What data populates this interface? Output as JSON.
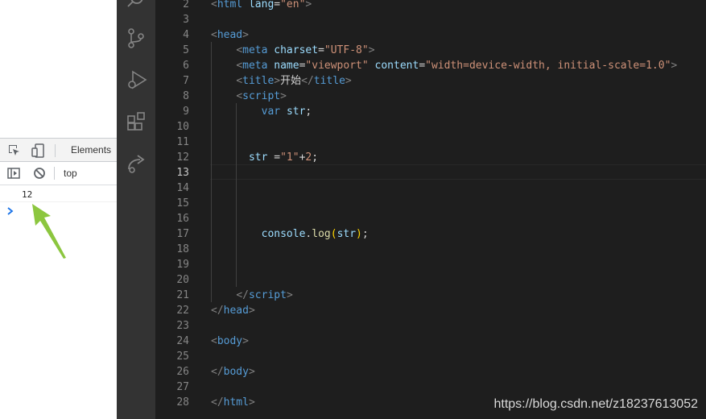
{
  "devtools": {
    "tab_label": "Elements",
    "context_label": "top",
    "console_output": "12",
    "icons": [
      "inspect-element-icon",
      "device-toggle-icon",
      "sidebar-toggle-icon",
      "clear-console-icon",
      "prompt-chevron-icon"
    ]
  },
  "activity_bar": {
    "icons": [
      "search-icon",
      "source-control-icon",
      "run-debug-icon",
      "extensions-icon",
      "remote-icon"
    ]
  },
  "editor": {
    "active_line": "13",
    "lines": [
      {
        "n": "2",
        "tokens": [
          [
            "t-punc",
            "<"
          ],
          [
            "t-tag",
            "html"
          ],
          [
            "t-txt",
            " "
          ],
          [
            "t-attr",
            "lang"
          ],
          [
            "t-txt",
            "="
          ],
          [
            "t-str",
            "\"en\""
          ],
          [
            "t-punc",
            ">"
          ]
        ]
      },
      {
        "n": "3",
        "tokens": []
      },
      {
        "n": "4",
        "tokens": [
          [
            "t-punc",
            "<"
          ],
          [
            "t-tag",
            "head"
          ],
          [
            "t-punc",
            ">"
          ]
        ]
      },
      {
        "n": "5",
        "tokens": [
          [
            "t-txt",
            "    "
          ],
          [
            "t-punc",
            "<"
          ],
          [
            "t-tag",
            "meta"
          ],
          [
            "t-txt",
            " "
          ],
          [
            "t-attr",
            "charset"
          ],
          [
            "t-txt",
            "="
          ],
          [
            "t-str",
            "\"UTF-8\""
          ],
          [
            "t-punc",
            ">"
          ]
        ]
      },
      {
        "n": "6",
        "tokens": [
          [
            "t-txt",
            "    "
          ],
          [
            "t-punc",
            "<"
          ],
          [
            "t-tag",
            "meta"
          ],
          [
            "t-txt",
            " "
          ],
          [
            "t-attr",
            "name"
          ],
          [
            "t-txt",
            "="
          ],
          [
            "t-str",
            "\"viewport\""
          ],
          [
            "t-txt",
            " "
          ],
          [
            "t-attr",
            "content"
          ],
          [
            "t-txt",
            "="
          ],
          [
            "t-str",
            "\"width=device-width, initial-scale=1.0\""
          ],
          [
            "t-punc",
            ">"
          ]
        ]
      },
      {
        "n": "7",
        "tokens": [
          [
            "t-txt",
            "    "
          ],
          [
            "t-punc",
            "<"
          ],
          [
            "t-tag",
            "title"
          ],
          [
            "t-punc",
            ">"
          ],
          [
            "t-txt",
            "开始"
          ],
          [
            "t-punc",
            "</"
          ],
          [
            "t-tag",
            "title"
          ],
          [
            "t-punc",
            ">"
          ]
        ]
      },
      {
        "n": "8",
        "tokens": [
          [
            "t-txt",
            "    "
          ],
          [
            "t-punc",
            "<"
          ],
          [
            "t-tag",
            "script"
          ],
          [
            "t-punc",
            ">"
          ]
        ]
      },
      {
        "n": "9",
        "tokens": [
          [
            "t-txt",
            "        "
          ],
          [
            "t-kw",
            "var"
          ],
          [
            "t-txt",
            " "
          ],
          [
            "t-var",
            "str"
          ],
          [
            "t-txt",
            ";"
          ]
        ]
      },
      {
        "n": "10",
        "tokens": []
      },
      {
        "n": "11",
        "tokens": []
      },
      {
        "n": "12",
        "tokens": [
          [
            "t-txt",
            "      "
          ],
          [
            "t-var",
            "str"
          ],
          [
            "t-txt",
            " ="
          ],
          [
            "t-str",
            "\"1\""
          ],
          [
            "t-txt",
            "+"
          ],
          [
            "t-str",
            "2"
          ],
          [
            "t-txt",
            ";"
          ]
        ]
      },
      {
        "n": "13",
        "tokens": []
      },
      {
        "n": "14",
        "tokens": []
      },
      {
        "n": "15",
        "tokens": []
      },
      {
        "n": "16",
        "tokens": []
      },
      {
        "n": "17",
        "tokens": [
          [
            "t-txt",
            "        "
          ],
          [
            "t-var",
            "console"
          ],
          [
            "t-txt",
            "."
          ],
          [
            "t-fn",
            "log"
          ],
          [
            "t-br",
            "("
          ],
          [
            "t-var",
            "str"
          ],
          [
            "t-br",
            ")"
          ],
          [
            "t-txt",
            ";"
          ]
        ]
      },
      {
        "n": "18",
        "tokens": []
      },
      {
        "n": "19",
        "tokens": []
      },
      {
        "n": "20",
        "tokens": []
      },
      {
        "n": "21",
        "tokens": [
          [
            "t-txt",
            "    "
          ],
          [
            "t-punc",
            "</"
          ],
          [
            "t-tag",
            "script"
          ],
          [
            "t-punc",
            ">"
          ]
        ]
      },
      {
        "n": "22",
        "tokens": [
          [
            "t-punc",
            "</"
          ],
          [
            "t-tag",
            "head"
          ],
          [
            "t-punc",
            ">"
          ]
        ]
      },
      {
        "n": "23",
        "tokens": []
      },
      {
        "n": "24",
        "tokens": [
          [
            "t-punc",
            "<"
          ],
          [
            "t-tag",
            "body"
          ],
          [
            "t-punc",
            ">"
          ]
        ]
      },
      {
        "n": "25",
        "tokens": []
      },
      {
        "n": "26",
        "tokens": [
          [
            "t-punc",
            "</"
          ],
          [
            "t-tag",
            "body"
          ],
          [
            "t-punc",
            ">"
          ]
        ]
      },
      {
        "n": "27",
        "tokens": []
      },
      {
        "n": "28",
        "tokens": [
          [
            "t-punc",
            "</"
          ],
          [
            "t-tag",
            "html"
          ],
          [
            "t-punc",
            ">"
          ]
        ]
      }
    ]
  },
  "watermark": "https://blog.csdn.net/z18237613052",
  "colors": {
    "editor_bg": "#1e1e1e",
    "activity_bg": "#333333",
    "tag": "#569cd6",
    "attr": "#9cdcfe",
    "string": "#ce9178",
    "function": "#dcdcaa",
    "arrow_annotation": "#8cc63f"
  }
}
